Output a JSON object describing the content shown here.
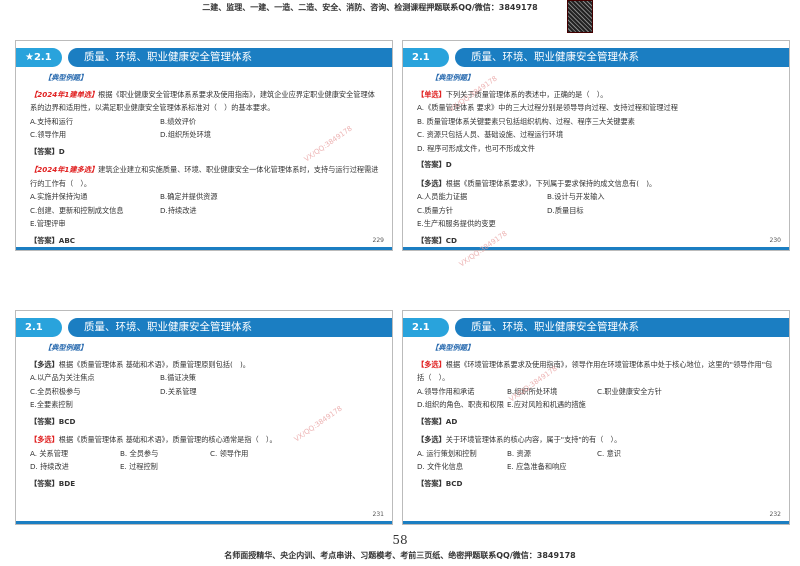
{
  "top_banner": "二建、监理、一建、一造、二造、安全、消防、咨询、检测课程押题联系QQ/微信：3849178",
  "watermark": "VX/QQ:3849178",
  "page_number": "58",
  "bottom_banner": "名师面授精华、央企内训、考点串讲、习题模考、考前三页纸、绝密押题联系QQ/微信：3849178",
  "slides": [
    {
      "num": "★2.1",
      "title": "质量、环境、职业健康安全管理体系",
      "tag": "【典型例题】",
      "page": "229",
      "indent": false,
      "questions": [
        {
          "prefix": "【2024年1建单选】",
          "style": "red",
          "stem": "根据《职业健康安全管理体系系要求及使用指南》，建筑企业应界定职业健康安全管理体系的边界和适用性，以满足职业健康安全管理体系标准对（　）的基本要求。",
          "options": [
            [
              "A.支持和运行",
              "B.绩效评价"
            ],
            [
              "C.领导作用",
              "D.组织所处环境"
            ]
          ],
          "answer": "【答案】D"
        },
        {
          "prefix": "【2024年1建多选】",
          "style": "red",
          "stem": "建筑企业建立和实施质量、环境、职业健康安全一体化管理体系时，支持与运行过程需进行的工作有（　）。",
          "options": [
            [
              "A.实施并保持沟通",
              "B.确定并提供资源"
            ],
            [
              "C.创建、更新和控制成文信息",
              "D.持续改进"
            ],
            [
              "E.管理评审"
            ]
          ],
          "answer": "【答案】ABC"
        }
      ]
    },
    {
      "num": "2.1",
      "title": "质量、环境、职业健康安全管理体系",
      "tag": "【典型例题】",
      "page": "230",
      "questions": [
        {
          "prefix": "【单选】",
          "style": "red2",
          "stem": "下列关于质量管理体系的表述中，正确的是（　）。",
          "options": [
            [
              "A.《质量管理体系 要求》中的三大过程分别是领导导向过程、支持过程和管理过程"
            ],
            [
              "B. 质量管理体系关键要素只包括组织机构、过程、程序三大关键要素"
            ],
            [
              "C. 资源只包括人员、基础设施、过程运行环境"
            ],
            [
              "D. 程序可形成文件，也可不形成文件"
            ]
          ],
          "answer": "【答案】D"
        },
        {
          "prefix": "【多选】",
          "style": "",
          "stem": "根据《质量管理体系要求》，下列属于要求保持的成文信息有(　)。",
          "options": [
            [
              "A.人员能力证据",
              "B.设计与开发输入"
            ],
            [
              "C.质量方针",
              "D.质量目标"
            ],
            [
              "E.生产和服务提供的变更"
            ]
          ],
          "answer": "【答案】CD"
        }
      ]
    },
    {
      "num": "2.1",
      "title": "质量、环境、职业健康安全管理体系",
      "tag": "【典型例题】",
      "page": "231",
      "questions": [
        {
          "prefix": "【多选】",
          "style": "",
          "stem": "根据《质量管理体系 基础和术语》，质量管理原则包括(　)。",
          "options": [
            [
              "A.以产品为关注焦点",
              "B.循证决策"
            ],
            [
              "C.全员积极参与",
              "D.关系管理"
            ],
            [
              "E.全要素控制"
            ]
          ],
          "answer": "【答案】BCD"
        },
        {
          "prefix": "【多选】",
          "style": "red2",
          "stem": "根据《质量管理体系 基础和术语》，质量管理的核心通常是指（　）。",
          "options": [
            [
              "A. 关系管理",
              "B. 全员参与",
              "C. 领导作用"
            ],
            [
              "D. 持续改进",
              "E. 过程控制"
            ]
          ],
          "answer": "【答案】BDE"
        }
      ]
    },
    {
      "num": "2.1",
      "title": "质量、环境、职业健康安全管理体系",
      "tag": "【典型例题】",
      "page": "232",
      "questions": [
        {
          "prefix": "【多选】",
          "style": "red2",
          "stem": "根据《环境管理体系要求及使用指南》，领导作用在环境管理体系中处于核心地位，这里的\"领导作用\"包括（　）。",
          "options": [
            [
              "A.领导作用和承诺",
              "B.组织所处环境",
              "C.职业健康安全方针"
            ],
            [
              "D.组织的角色、职责和权限",
              "E.应对风险和机遇的措施"
            ]
          ],
          "answer": "【答案】AD"
        },
        {
          "prefix": "【多选】",
          "style": "",
          "stem": "关于环境管理体系的核心内容，属于\"支持\"的有（　）。",
          "options": [
            [
              "A. 运行策划和控制",
              "B. 资源",
              "C. 意识"
            ],
            [
              "D. 文件化信息",
              "E. 应急准备和响应"
            ]
          ],
          "answer": "【答案】BCD"
        }
      ]
    }
  ]
}
